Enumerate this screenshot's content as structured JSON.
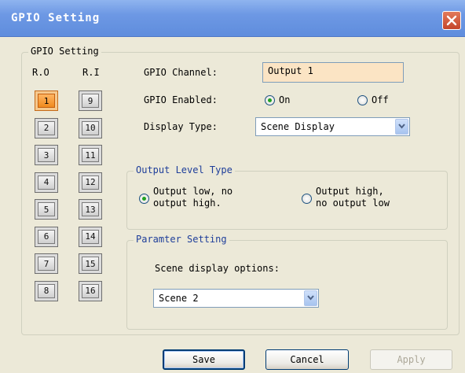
{
  "window": {
    "title": "GPIO Setting"
  },
  "group": {
    "title": "GPIO Setting"
  },
  "columns": {
    "ro_label": "R.O",
    "ri_label": "R.I"
  },
  "ro_buttons": [
    "1",
    "2",
    "3",
    "4",
    "5",
    "6",
    "7",
    "8"
  ],
  "ri_buttons": [
    "9",
    "10",
    "11",
    "12",
    "13",
    "14",
    "15",
    "16"
  ],
  "selected_button": "1",
  "channel": {
    "label": "GPIO Channel:",
    "value": "Output 1"
  },
  "enabled": {
    "label": "GPIO Enabled:",
    "on_label": "On",
    "off_label": "Off",
    "selected": "On"
  },
  "display_type": {
    "label": "Display Type:",
    "value": "Scene Display"
  },
  "output_level": {
    "title": "Output Level Type",
    "option1_line1": "Output low, no",
    "option1_line2": "output high.",
    "option2_line1": "Output high,",
    "option2_line2": "no output low",
    "selected": "option1"
  },
  "param": {
    "title": "Paramter Setting",
    "scene_label": "Scene display options:",
    "scene_value": "Scene 2"
  },
  "buttons": {
    "save": "Save",
    "cancel": "Cancel",
    "apply": "Apply"
  },
  "colors": {
    "title_bar": "#6d98e4",
    "active_button": "#f08a1e",
    "channel_field": "#fbe4c4"
  }
}
